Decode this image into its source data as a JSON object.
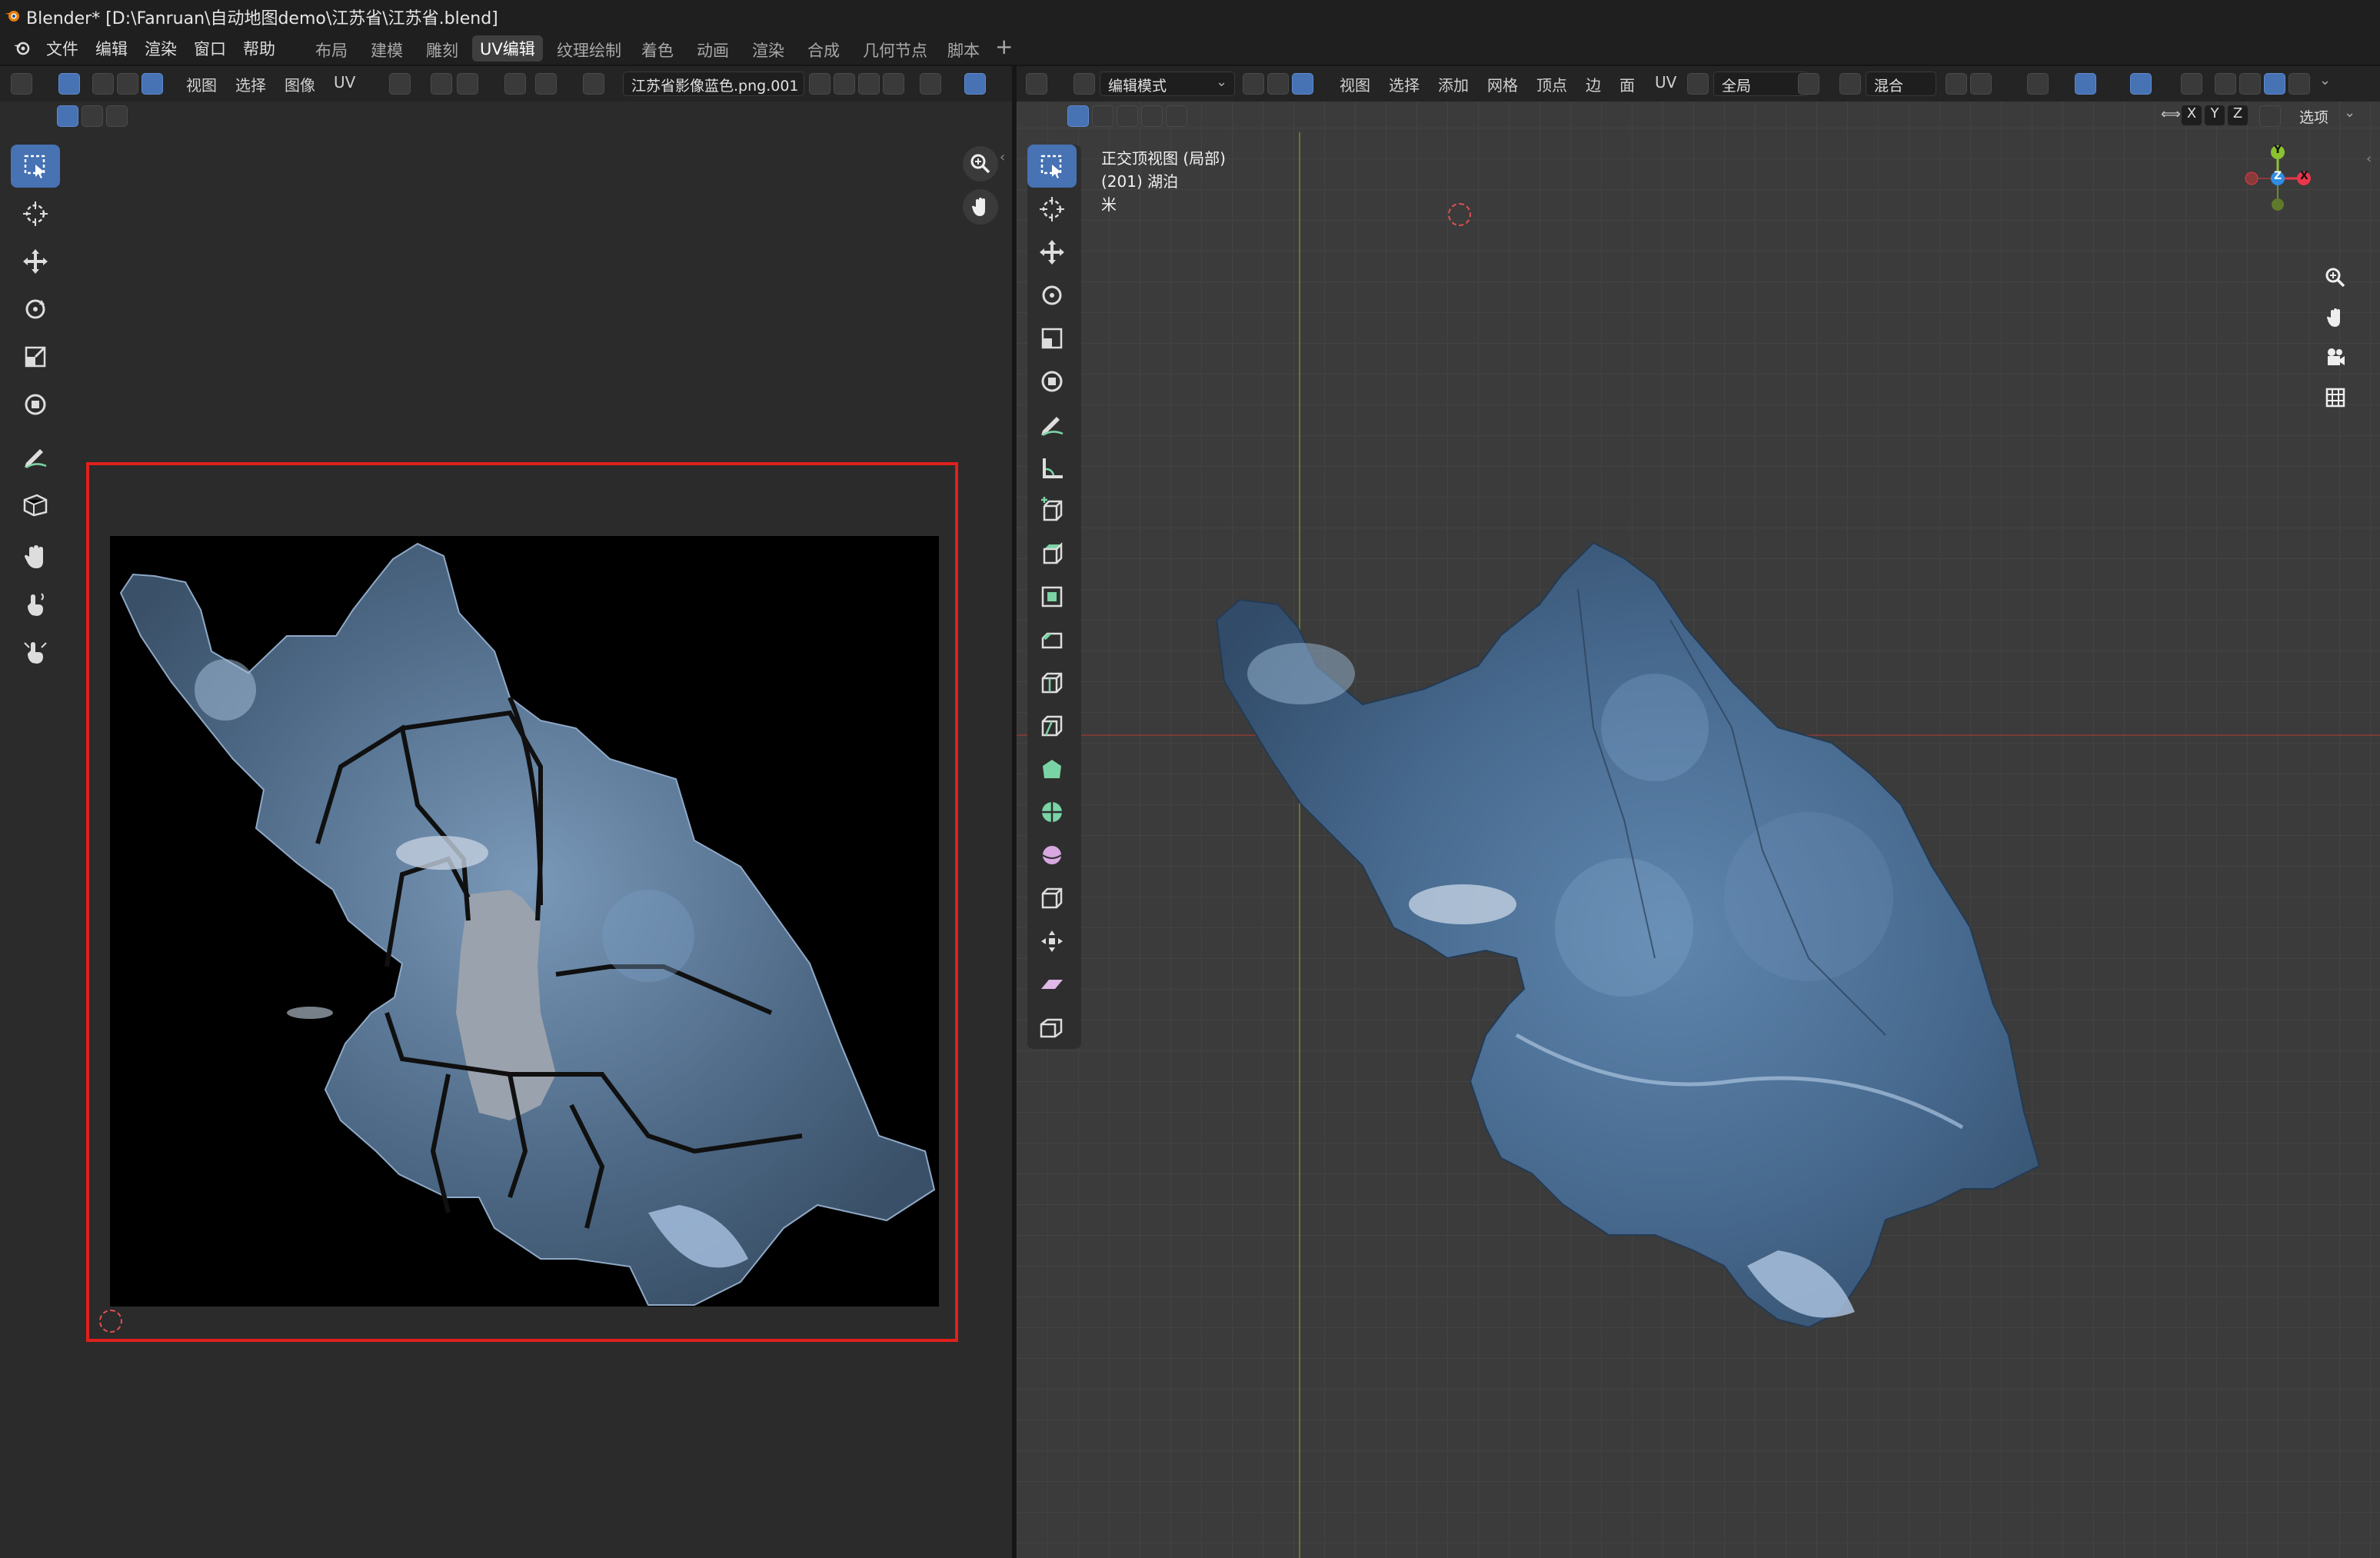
{
  "window": {
    "title": "Blender* [D:\\Fanruan\\自动地图demo\\江苏省\\江苏省.blend]"
  },
  "menu": [
    "文件",
    "编辑",
    "渲染",
    "窗口",
    "帮助"
  ],
  "workspaces": [
    "布局",
    "建模",
    "雕刻",
    "UV编辑",
    "纹理绘制",
    "着色",
    "动画",
    "渲染",
    "合成",
    "几何节点",
    "脚本"
  ],
  "active_workspace": "UV编辑",
  "add_workspace_icon": "plus-icon",
  "uv_editor": {
    "header_menus": [
      "视图",
      "选择",
      "图像",
      "UV"
    ],
    "image_name": "江苏省影像蓝色.png.001",
    "tools": [
      "select-box-icon",
      "cursor-icon",
      "move-icon",
      "rotate-icon",
      "scale-icon",
      "transform-icon",
      "annotate-icon",
      "rip-icon",
      "grab-icon",
      "relax-icon",
      "pinch-icon"
    ],
    "nav": [
      "zoom-icon",
      "hand-icon"
    ]
  },
  "viewport": {
    "mode": "编辑模式",
    "header_menus": [
      "视图",
      "选择",
      "添加",
      "网格",
      "顶点",
      "边",
      "面",
      "UV"
    ],
    "transform_orientation": "全局",
    "snap_mode": "混合",
    "overlay_lines": [
      "正交顶视图 (局部)",
      "(201) 湖泊",
      "米"
    ],
    "axis_buttons": [
      "X",
      "Y",
      "Z"
    ],
    "options_label": "选项",
    "gizmo": {
      "x": "X",
      "y": "Y",
      "z": "Z"
    },
    "tools": [
      "select-box-icon",
      "cursor-icon",
      "move-icon",
      "rotate-icon",
      "scale-icon",
      "transform-icon",
      "annotate-icon",
      "measure-icon",
      "add-cube-icon",
      "extrude-icon",
      "inset-icon",
      "bevel-icon",
      "loop-cut-icon",
      "knife-icon",
      "poly-build-icon",
      "spin-icon",
      "smooth-icon",
      "edge-slide-icon",
      "shrink-icon",
      "shear-icon",
      "rip-region-icon"
    ],
    "nav": [
      "zoom-icon",
      "hand-icon",
      "camera-icon",
      "grid-icon"
    ]
  },
  "colors": {
    "accent": "#4772b3",
    "frame": "#e0201c",
    "x_axis": "#e8364a",
    "y_axis": "#8bc22f",
    "z_axis": "#2f8de4"
  }
}
